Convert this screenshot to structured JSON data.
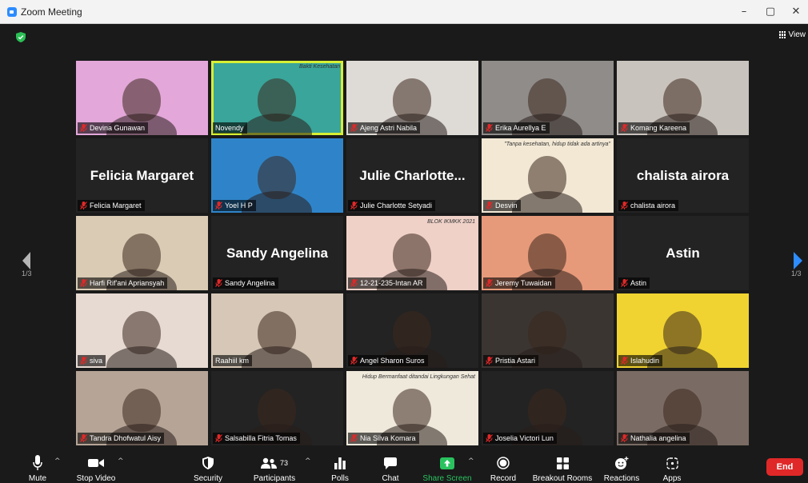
{
  "window": {
    "title": "Zoom Meeting",
    "minimize": "–",
    "maximize": "▢",
    "close": "✕"
  },
  "top_bar": {
    "view_label": "View",
    "page_indicator_left": "1/3",
    "page_indicator_right": "1/3"
  },
  "colors": {
    "active_speaker": "#d6ef34",
    "accent": "#2d8cff",
    "end": "#e02828",
    "share": "#29c25f",
    "muted_icon": "#e02828"
  },
  "participants": [
    {
      "name": "Devina Gunawan",
      "muted": true,
      "video": true,
      "big_name": "",
      "bg": "#e3a7d9"
    },
    {
      "name": "Novendy",
      "muted": false,
      "video": true,
      "big_name": "",
      "bg": "#3aa59a",
      "active": true,
      "overlay_text": "Bakti Kesehatan"
    },
    {
      "name": "Ajeng Astri Nabila",
      "muted": true,
      "video": true,
      "big_name": "",
      "bg": "#dedad6"
    },
    {
      "name": "Erika Aurellya E",
      "muted": true,
      "video": true,
      "big_name": "",
      "bg": "#8f8c8a"
    },
    {
      "name": "Komang Kareena",
      "muted": true,
      "video": true,
      "big_name": "",
      "bg": "#c9c3bd"
    },
    {
      "name": "Felicia Margaret",
      "muted": true,
      "video": false,
      "big_name": "Felicia Margaret",
      "bg": "#232323"
    },
    {
      "name": "Yoel H P",
      "muted": true,
      "video": true,
      "big_name": "",
      "bg": "#2f84c9"
    },
    {
      "name": "Julie Charlotte Setyadi",
      "muted": true,
      "video": false,
      "big_name": "Julie  Charlotte...",
      "bg": "#232323"
    },
    {
      "name": "Desvin",
      "muted": true,
      "video": true,
      "big_name": "",
      "bg": "#f2e8d4",
      "overlay_text": "\"Tanpa kesehatan, hidup tidak ada artinya\""
    },
    {
      "name": "chalista airora",
      "muted": true,
      "video": false,
      "big_name": "chalista airora",
      "bg": "#232323"
    },
    {
      "name": "Harfi Rif'ani Apriansyah",
      "muted": true,
      "video": true,
      "big_name": "",
      "bg": "#d9cbb4"
    },
    {
      "name": "Sandy Angelina",
      "muted": true,
      "video": false,
      "big_name": "Sandy Angelina",
      "bg": "#232323"
    },
    {
      "name": "12-21-235-Intan AR",
      "muted": true,
      "video": true,
      "big_name": "",
      "bg": "#efd1c8",
      "overlay_text": "BLOK IKMKK 2021"
    },
    {
      "name": "Jeremy Tuwaidan",
      "muted": true,
      "video": true,
      "big_name": "",
      "bg": "#e79a7a"
    },
    {
      "name": "Astin",
      "muted": true,
      "video": false,
      "big_name": "Astin",
      "bg": "#232323"
    },
    {
      "name": "siva",
      "muted": true,
      "video": true,
      "big_name": "",
      "bg": "#e7dad3"
    },
    {
      "name": "Raahiil km",
      "muted": false,
      "video": true,
      "big_name": "",
      "bg": "#d6c7b6"
    },
    {
      "name": "Angel Sharon Suros",
      "muted": true,
      "video": true,
      "big_name": "",
      "bg": "#232323"
    },
    {
      "name": "Pristia Astari",
      "muted": true,
      "video": true,
      "big_name": "",
      "bg": "#3b3532"
    },
    {
      "name": "Islahudin",
      "muted": true,
      "video": true,
      "big_name": "",
      "bg": "#f0d330"
    },
    {
      "name": "Tandra Dhofwatul Aisy",
      "muted": true,
      "video": true,
      "big_name": "",
      "bg": "#b6a597"
    },
    {
      "name": "Salsabilla Fitria Tomas",
      "muted": true,
      "video": true,
      "big_name": "",
      "bg": "#232323"
    },
    {
      "name": "Nia Silva Komara",
      "muted": true,
      "video": true,
      "big_name": "",
      "bg": "#efe9dc",
      "overlay_text": "Hidup Bermanfaat ditandai Lingkungan Sehat"
    },
    {
      "name": "Joselia Victori Lun",
      "muted": true,
      "video": true,
      "big_name": "",
      "bg": "#232323"
    },
    {
      "name": "Nathalia angelina",
      "muted": true,
      "video": true,
      "big_name": "",
      "bg": "#7a6c64"
    }
  ],
  "toolbar": {
    "mute": "Mute",
    "stop_video": "Stop Video",
    "security": "Security",
    "participants": "Participants",
    "participants_count": "73",
    "polls": "Polls",
    "chat": "Chat",
    "share_screen": "Share Screen",
    "record": "Record",
    "breakout_rooms": "Breakout Rooms",
    "reactions": "Reactions",
    "apps": "Apps",
    "end": "End",
    "caret": "^"
  }
}
